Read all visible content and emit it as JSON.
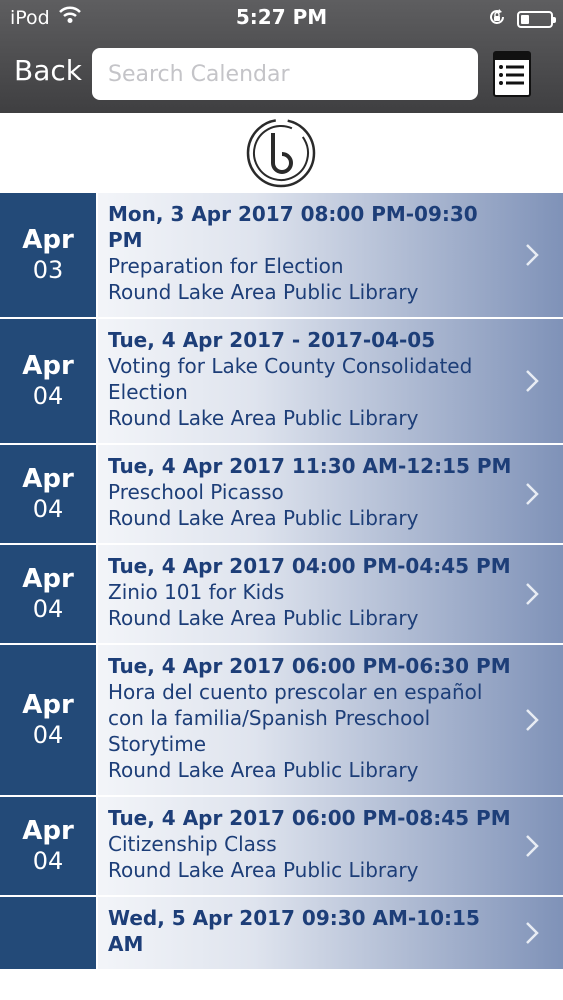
{
  "status_bar": {
    "carrier": "iPod",
    "time": "5:27 PM",
    "battery_level": 0.3
  },
  "nav": {
    "back_label": "Back",
    "search_placeholder": "Search Calendar",
    "list_icon": "list-icon"
  },
  "colors": {
    "date_block": "#234a78",
    "event_text": "#1d3e78",
    "nav_bar": "#4a4a4c"
  },
  "events": [
    {
      "month": "Apr",
      "day": "03",
      "datetime": "Mon, 3 Apr 2017 08:00 PM-09:30 PM",
      "title": "Preparation for Election",
      "location": "Round Lake Area Public Library"
    },
    {
      "month": "Apr",
      "day": "04",
      "datetime": "Tue, 4 Apr 2017 - 2017-04-05",
      "title": "Voting for Lake County Consolidated Election",
      "location": "Round Lake Area Public Library"
    },
    {
      "month": "Apr",
      "day": "04",
      "datetime": "Tue, 4 Apr 2017 11:30 AM-12:15 PM",
      "title": "Preschool Picasso",
      "location": "Round Lake Area Public Library"
    },
    {
      "month": "Apr",
      "day": "04",
      "datetime": "Tue, 4 Apr 2017 04:00 PM-04:45 PM",
      "title": "Zinio 101 for Kids",
      "location": "Round Lake Area Public Library"
    },
    {
      "month": "Apr",
      "day": "04",
      "datetime": "Tue, 4 Apr 2017 06:00 PM-06:30 PM",
      "title": "Hora del cuento prescolar en español con la familia/Spanish Preschool Storytime",
      "location": "Round Lake Area Public Library"
    },
    {
      "month": "Apr",
      "day": "04",
      "datetime": "Tue, 4 Apr 2017 06:00 PM-08:45 PM",
      "title": "Citizenship Class",
      "location": "Round Lake Area Public Library"
    },
    {
      "month": "",
      "day": "",
      "datetime": "Wed, 5 Apr 2017 09:30 AM-10:15 AM",
      "title": "",
      "location": ""
    }
  ]
}
